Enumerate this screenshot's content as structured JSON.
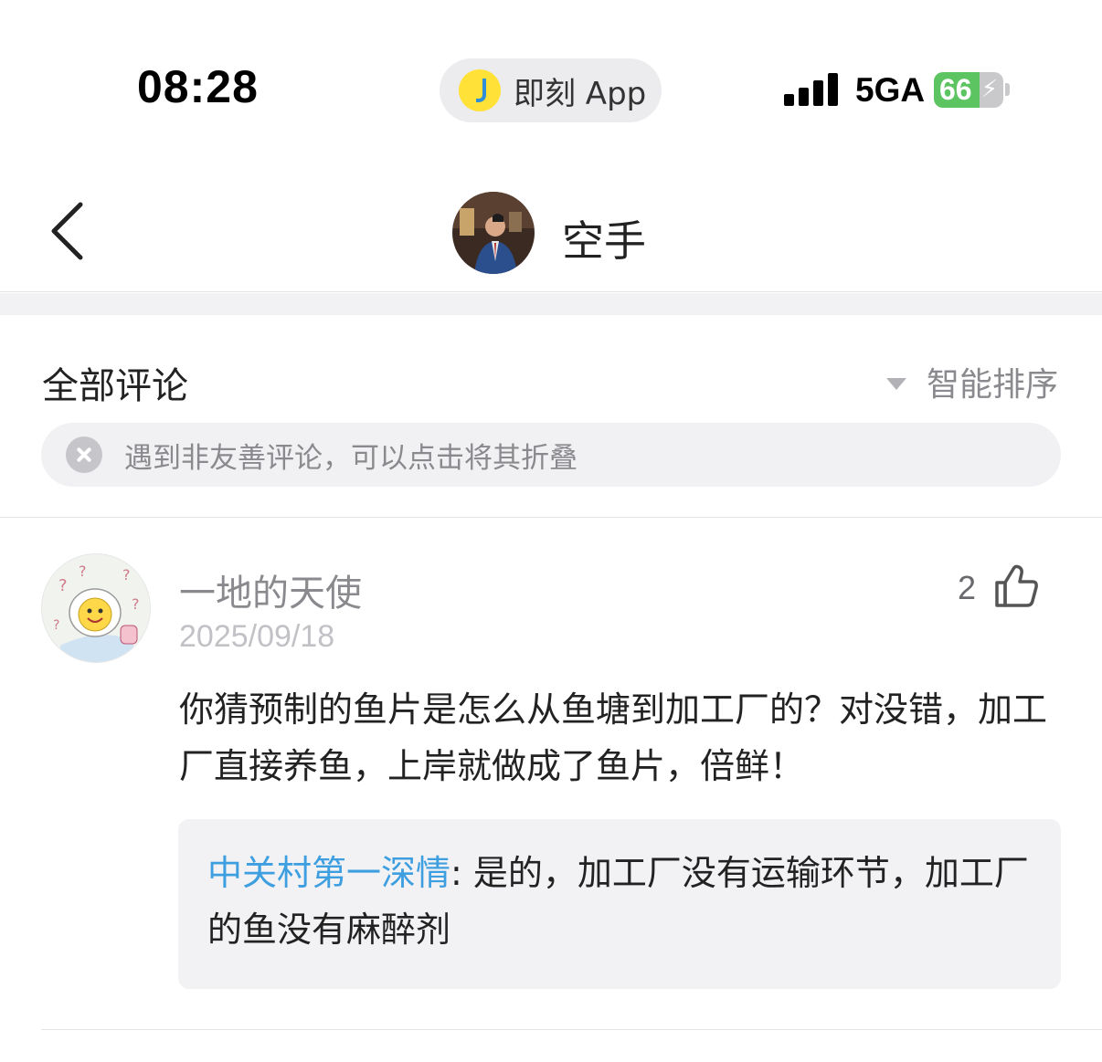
{
  "status_bar": {
    "time": "08:28",
    "app_name": "即刻 App",
    "network": "5GA",
    "battery_level": "66",
    "battery_fraction": 0.66,
    "signal_bars": 4
  },
  "nav": {
    "title": "空手"
  },
  "comments": {
    "header": "全部评论",
    "sort_label": "智能排序",
    "tip_text": "遇到非友善评论，可以点击将其折叠",
    "items": [
      {
        "author": "一地的天使",
        "date": "2025/09/18",
        "likes": "2",
        "body": "你猜预制的鱼片是怎么从鱼塘到加工厂的？对没错，加工厂直接养鱼，上岸就做成了鱼片，倍鲜！",
        "reply": {
          "author": "中关村第一深情",
          "separator": ": ",
          "text": "是的，加工厂没有运输环节，加工厂的鱼没有麻醉剂"
        }
      }
    ]
  },
  "colors": {
    "accent_link": "#3d9ee0",
    "battery_green": "#5dc462",
    "app_icon_yellow": "#ffe138"
  }
}
